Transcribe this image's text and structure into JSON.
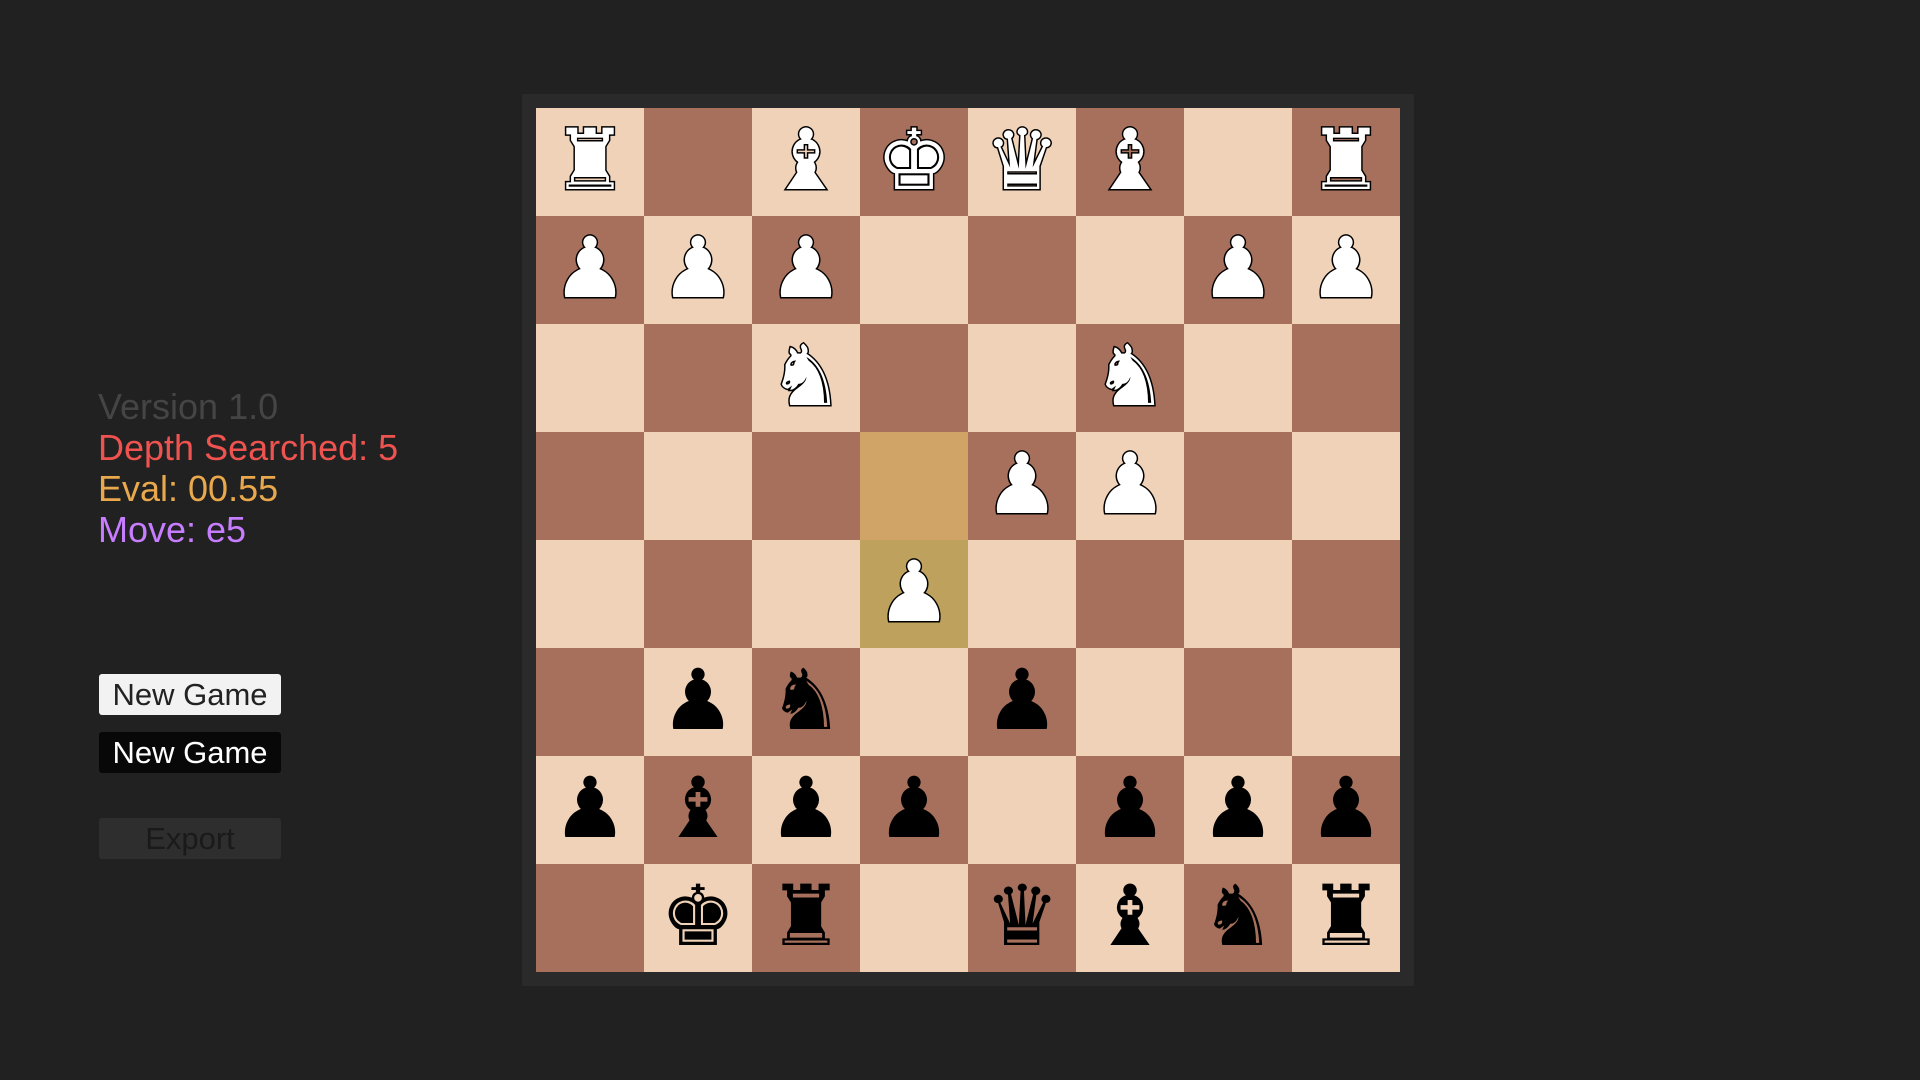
{
  "info": {
    "version": "Version 1.0",
    "depth": "Depth Searched: 5",
    "eval": "Eval: 00.55",
    "move": "Move: e5"
  },
  "colors": {
    "version": "#454545",
    "depth": "#ef5350",
    "eval": "#e9a84c",
    "move": "#c77dff",
    "light_square": "#f0d2b9",
    "dark_square": "#a6705c",
    "highlight_from": "#cfa466",
    "highlight_to": "#bea15c"
  },
  "buttons": {
    "new_game_light": "New Game",
    "new_game_dark": "New Game",
    "export": "Export"
  },
  "board": {
    "orientation": "black-bottom",
    "highlight": [
      [
        3,
        3,
        "from"
      ],
      [
        4,
        3,
        "to"
      ]
    ],
    "rows": [
      [
        "wR",
        "",
        "wB",
        "wK",
        "wQ",
        "wB",
        "",
        "wR"
      ],
      [
        "wP",
        "wP",
        "wP",
        "",
        "",
        "",
        "wP",
        "wP"
      ],
      [
        "",
        "",
        "wN",
        "",
        "",
        "wN",
        "",
        ""
      ],
      [
        "",
        "",
        "",
        "",
        "wP",
        "wP",
        "",
        ""
      ],
      [
        "",
        "",
        "",
        "wP",
        "",
        "",
        "",
        ""
      ],
      [
        "",
        "bP",
        "bN",
        "",
        "bP",
        "",
        "",
        ""
      ],
      [
        "bP",
        "bB",
        "bP",
        "bP",
        "",
        "bP",
        "bP",
        "bP"
      ],
      [
        "",
        "bK",
        "bR",
        "",
        "bQ",
        "bB",
        "bN",
        "bR"
      ]
    ]
  }
}
